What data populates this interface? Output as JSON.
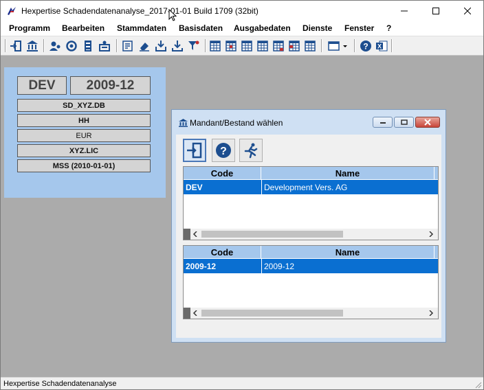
{
  "window": {
    "title": "Hexpertise Schadendatenanalyse_2017-01-01 Build 1709 (32bit)"
  },
  "menu": {
    "items": [
      "Programm",
      "Bearbeiten",
      "Stammdaten",
      "Basisdaten",
      "Ausgabedaten",
      "Dienste",
      "Fenster",
      "?"
    ]
  },
  "info_panel": {
    "mandant": "DEV",
    "bestand": "2009-12",
    "database": "SD_XYZ.DB",
    "currency_region": "HH",
    "currency": "EUR",
    "license": "XYZ.LIC",
    "mss": "MSS (2010-01-01)"
  },
  "dialog": {
    "title": "Mandant/Bestand wählen",
    "grid1": {
      "headers": [
        "Code",
        "Name"
      ],
      "rows": [
        {
          "code": "DEV",
          "name": "Development Vers. AG"
        }
      ]
    },
    "grid2": {
      "headers": [
        "Code",
        "Name"
      ],
      "rows": [
        {
          "code": "2009-12",
          "name": "2009-12"
        }
      ]
    }
  },
  "status": {
    "text": "Hexpertise Schadendatenanalyse"
  },
  "colors": {
    "panel_blue": "#a5c7ec",
    "selection_blue": "#0a6fd1",
    "workspace_gray": "#ababab"
  }
}
